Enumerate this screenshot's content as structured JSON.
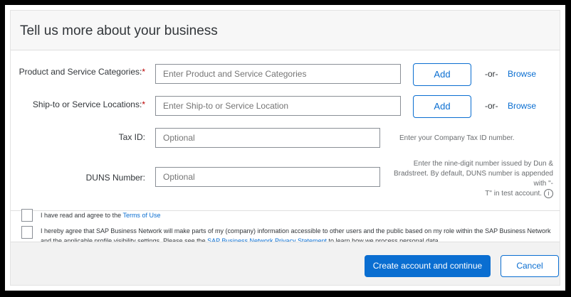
{
  "form": {
    "title": "Tell us more about your business",
    "product": {
      "label": "Product and Service Categories:",
      "required_mark": "*",
      "placeholder": "Enter Product and Service Categories",
      "add_label": "Add",
      "or_label": "-or-",
      "browse_label": "Browse"
    },
    "shipto": {
      "label": "Ship-to or Service Locations:",
      "required_mark": "*",
      "placeholder": "Enter Ship-to or Service Location",
      "add_label": "Add",
      "or_label": "-or-",
      "browse_label": "Browse"
    },
    "taxid": {
      "label": "Tax ID:",
      "placeholder": "Optional",
      "hint": "Enter your Company Tax ID number."
    },
    "duns": {
      "label": "DUNS Number:",
      "placeholder": "Optional",
      "hint_line1": "Enter the nine-digit number issued by Dun &",
      "hint_line2": "Bradstreet. By default, DUNS number is appended with \"-",
      "hint_line3": "T\" in test account.",
      "info_icon": "i"
    }
  },
  "agreements": {
    "terms_text": "I have read and agree to the ",
    "terms_link": "Terms of Use",
    "privacy_text_1": "I hereby agree that SAP Business Network will make parts of my (company) information accessible to other users and the public based on my role within the SAP Business Network",
    "privacy_text_2": "and the applicable profile visibility settings. Please see the ",
    "privacy_link": "SAP Business Network Privacy Statement",
    "privacy_text_3": " to learn how we process personal data."
  },
  "footer": {
    "create_label": "Create account and continue",
    "cancel_label": "Cancel"
  },
  "colors": {
    "accent": "#0a6ed1",
    "required": "#bb0000"
  }
}
